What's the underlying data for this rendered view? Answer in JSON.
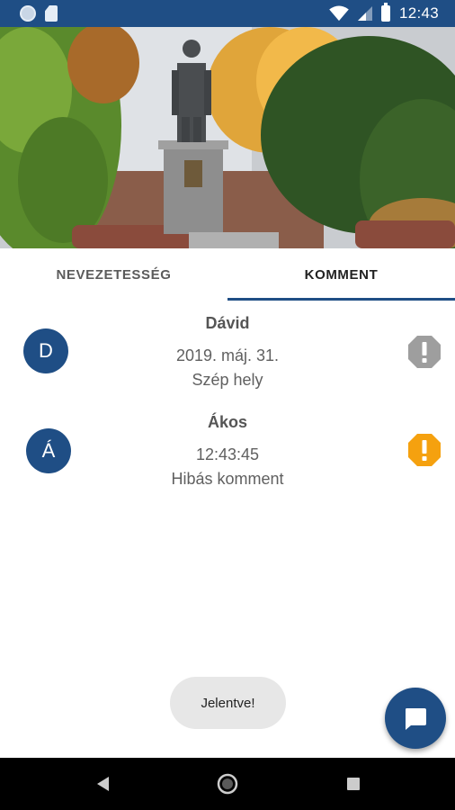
{
  "status_bar": {
    "time": "12:43",
    "icons": [
      "notification-dot-icon",
      "sd-card-icon",
      "wifi-icon",
      "signal-icon",
      "battery-icon"
    ]
  },
  "hero": {
    "image": "statue-photo"
  },
  "tabs": [
    {
      "label": "NEVEZETESSÉG",
      "selected": false
    },
    {
      "label": "KOMMENT",
      "selected": true
    }
  ],
  "comments": [
    {
      "avatar_letter": "D",
      "author": "Dávid",
      "date": "2019. máj. 31.",
      "text": "Szép hely",
      "report_icon": "report-icon",
      "report_color": "#9e9e9e"
    },
    {
      "avatar_letter": "Á",
      "author": "Ákos",
      "date": "12:43:45",
      "text": "Hibás komment",
      "report_icon": "report-icon",
      "report_color": "#f5a10f"
    }
  ],
  "toast": {
    "message": "Jelentve!"
  },
  "fab": {
    "icon": "chat-icon"
  },
  "nav_bar": {
    "icons": [
      "back-icon",
      "home-icon",
      "recents-icon"
    ]
  },
  "colors": {
    "primary": "#1f4e85",
    "report_neutral": "#9e9e9e",
    "report_active": "#f5a10f"
  }
}
